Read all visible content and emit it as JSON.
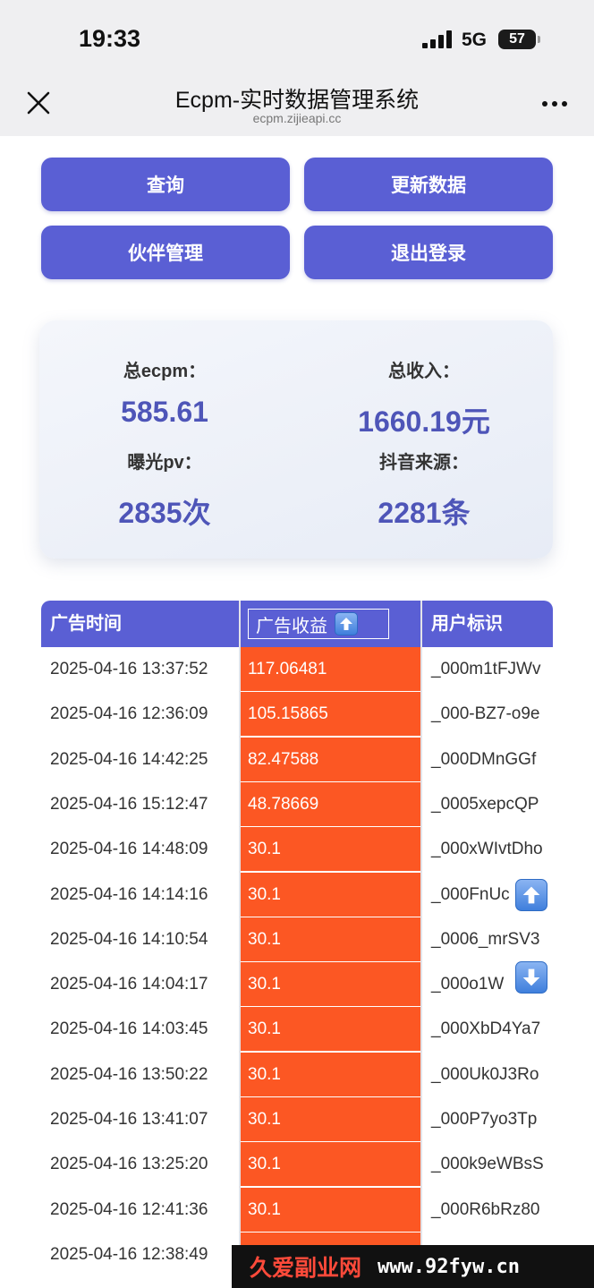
{
  "status_bar": {
    "time": "19:33",
    "network": "5G",
    "battery": "57"
  },
  "header": {
    "title": "Ecpm-实时数据管理系统",
    "url": "ecpm.zijieapi.cc"
  },
  "actions": {
    "query": "查询",
    "update": "更新数据",
    "partners": "伙伴管理",
    "logout": "退出登录"
  },
  "stats": {
    "total_ecpm_label": "总ecpm：",
    "total_ecpm_value": "585.61",
    "total_income_label": "总收入：",
    "total_income_value": "1660.19元",
    "pv_label": "曝光pv：",
    "pv_value": "2835次",
    "source_label": "抖音来源：",
    "source_value": "2281条"
  },
  "table": {
    "headers": {
      "time": "广告时间",
      "revenue": "广告收益",
      "user": "用户标识"
    },
    "rows": [
      {
        "time": "2025-04-16 13:37:52",
        "revenue": "117.06481",
        "user": "_000m1tFJWv"
      },
      {
        "time": "2025-04-16 12:36:09",
        "revenue": "105.15865",
        "user": "_000-BZ7-o9e"
      },
      {
        "time": "2025-04-16 14:42:25",
        "revenue": "82.47588",
        "user": "_000DMnGGf"
      },
      {
        "time": "2025-04-16 15:12:47",
        "revenue": "48.78669",
        "user": "_0005xepcQP"
      },
      {
        "time": "2025-04-16 14:48:09",
        "revenue": "30.1",
        "user": "_000xWIvtDho"
      },
      {
        "time": "2025-04-16 14:14:16",
        "revenue": "30.1",
        "user": "_000FnUc"
      },
      {
        "time": "2025-04-16 14:10:54",
        "revenue": "30.1",
        "user": "_0006_mrSV3"
      },
      {
        "time": "2025-04-16 14:04:17",
        "revenue": "30.1",
        "user": "_000o1W"
      },
      {
        "time": "2025-04-16 14:03:45",
        "revenue": "30.1",
        "user": "_000XbD4Ya7"
      },
      {
        "time": "2025-04-16 13:50:22",
        "revenue": "30.1",
        "user": "_000Uk0J3Ro"
      },
      {
        "time": "2025-04-16 13:41:07",
        "revenue": "30.1",
        "user": "_000P7yo3Tp"
      },
      {
        "time": "2025-04-16 13:25:20",
        "revenue": "30.1",
        "user": "_000k9eWBsS"
      },
      {
        "time": "2025-04-16 12:41:36",
        "revenue": "30.1",
        "user": "_000R6bRz80"
      },
      {
        "time": "2025-04-16 12:38:49",
        "revenue": "",
        "user": ""
      }
    ]
  },
  "icons": {
    "close": "close-icon",
    "more": "more-icon",
    "sort": "arrow-up-icon",
    "scroll_up": "arrow-up-icon",
    "scroll_down": "arrow-down-icon"
  },
  "colors": {
    "primary": "#5a5fd4",
    "revenue_cell": "#fc5723",
    "stat_value": "#4e55b8"
  },
  "watermark": {
    "brand": "久爱副业网",
    "url": "www.92fyw.cn"
  }
}
